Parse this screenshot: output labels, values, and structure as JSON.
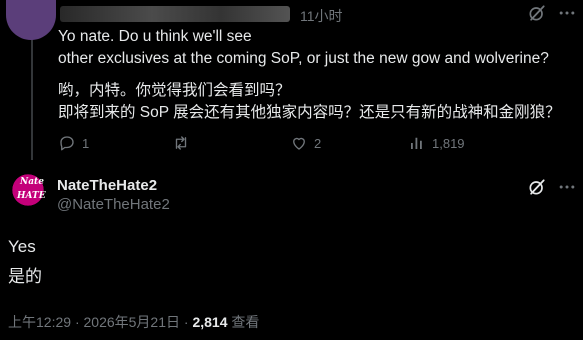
{
  "reply": {
    "timestamp": "11小时",
    "lines_en": [
      "Yo nate. Do u think we'll see",
      "other exclusives at the coming SoP, or just the new gow and wolverine?"
    ],
    "lines_zh": [
      "哟，内特。你觉得我们会看到吗？",
      "即将到来的 SoP 展会还有其他独家内容吗？还是只有新的战神和金刚狼？"
    ],
    "actions": {
      "replies": "1",
      "retweets": "",
      "likes": "2",
      "views": "1,819"
    }
  },
  "tweet": {
    "display_name": "NateTheHate2",
    "handle": "@NateTheHate2",
    "avatar_text_top": "Nate",
    "avatar_text_bottom": "HATE",
    "lines": [
      "Yes",
      "是的"
    ],
    "time": "上午12:29",
    "sep": "·",
    "date": "2026年5月21日",
    "views_count": "2,814",
    "views_label": "查看"
  },
  "icons": {
    "grok": "grok-icon",
    "more": "more-icon",
    "reply": "reply-icon",
    "retweet": "retweet-icon",
    "like": "like-icon",
    "views": "views-icon"
  }
}
